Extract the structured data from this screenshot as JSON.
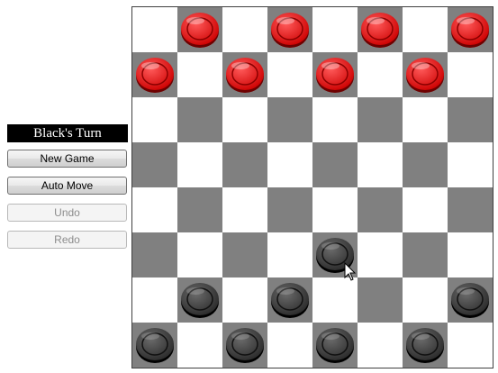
{
  "status": {
    "turn_label": "Black's Turn"
  },
  "controls": {
    "new_game_label": "New Game",
    "auto_move_label": "Auto Move",
    "undo_label": "Undo",
    "redo_label": "Redo",
    "undo_enabled": false,
    "redo_enabled": false
  },
  "board": {
    "size": 8,
    "colors": {
      "light_square": "#ffffff",
      "dark_square": "#808080",
      "red_piece": "#cc0000",
      "black_piece": "#2a2a2a"
    },
    "rows": [
      [
        "",
        "r",
        "",
        "r",
        "",
        "r",
        "",
        "r"
      ],
      [
        "r",
        "",
        "r",
        "",
        "r",
        "",
        "r",
        ""
      ],
      [
        "",
        "",
        "",
        "",
        "",
        "",
        "",
        ""
      ],
      [
        "",
        "",
        "",
        "",
        "",
        "",
        "",
        ""
      ],
      [
        "",
        "",
        "",
        "",
        "",
        "",
        "",
        ""
      ],
      [
        "",
        "",
        "",
        "",
        "b",
        "",
        "",
        ""
      ],
      [
        "",
        "b",
        "",
        "b",
        "",
        "",
        "",
        "b"
      ],
      [
        "b",
        "",
        "b",
        "",
        "b",
        "",
        "b",
        ""
      ]
    ]
  }
}
